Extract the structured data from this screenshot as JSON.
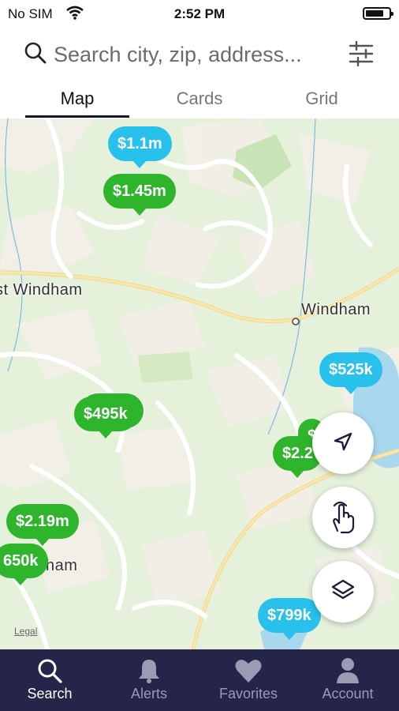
{
  "status_bar": {
    "carrier": "No SIM",
    "time": "2:52 PM"
  },
  "search": {
    "placeholder": "Search city, zip, address..."
  },
  "tabs": [
    {
      "label": "Map"
    },
    {
      "label": "Cards"
    },
    {
      "label": "Grid"
    }
  ],
  "map": {
    "labels": [
      {
        "text": "st Windham"
      },
      {
        "text": "Windham"
      },
      {
        "text": "ham"
      }
    ],
    "legal": "Legal",
    "pins": [
      {
        "price": "$1.1m",
        "color": "blue"
      },
      {
        "price": "$1.45m",
        "color": "green"
      },
      {
        "price": "$525k",
        "color": "blue"
      },
      {
        "price": "$495k",
        "color": "green"
      },
      {
        "price": "$",
        "color": "green"
      },
      {
        "price": "$2.2",
        "color": "green"
      },
      {
        "price": "$2.19m",
        "color": "green"
      },
      {
        "price": "650k",
        "color": "green"
      },
      {
        "price": "$799k",
        "color": "blue"
      }
    ]
  },
  "bottom_nav": [
    {
      "label": "Search",
      "icon": "search-icon",
      "active": true
    },
    {
      "label": "Alerts",
      "icon": "bell-icon"
    },
    {
      "label": "Favorites",
      "icon": "heart-icon"
    },
    {
      "label": "Account",
      "icon": "person-icon"
    }
  ],
  "colors": {
    "green_pin": "#2fb52b",
    "blue_pin": "#27c1ec",
    "tabbar": "#25254a",
    "map_bg": "#e6f1dc"
  }
}
